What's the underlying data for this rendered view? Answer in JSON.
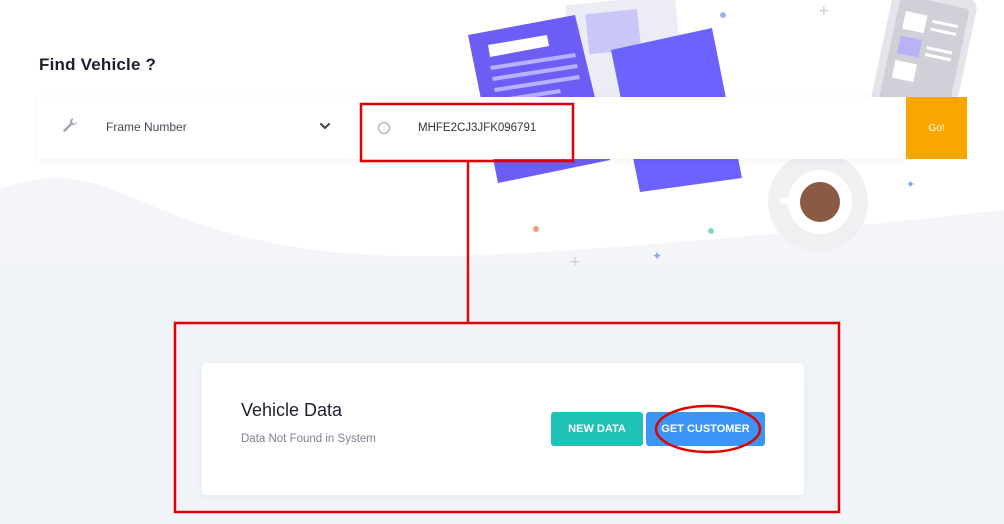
{
  "page": {
    "title": "Find Vehicle ?"
  },
  "search": {
    "filter_label": "Frame Number",
    "input_value": "MHFE2CJ3JFK096791",
    "go_label": "Go!"
  },
  "result": {
    "title": "Vehicle Data",
    "subtitle": "Data Not Found in System",
    "new_data_label": "NEW DATA",
    "get_customer_label": "GET CUSTOMER"
  },
  "colors": {
    "go_button": "#f9a602",
    "new_data_button": "#1fc2b5",
    "get_customer_button": "#3a95f5",
    "annotation": "#e00000"
  },
  "icons": [
    "wrench-icon",
    "chevron-down-icon",
    "radio-circle-icon"
  ]
}
